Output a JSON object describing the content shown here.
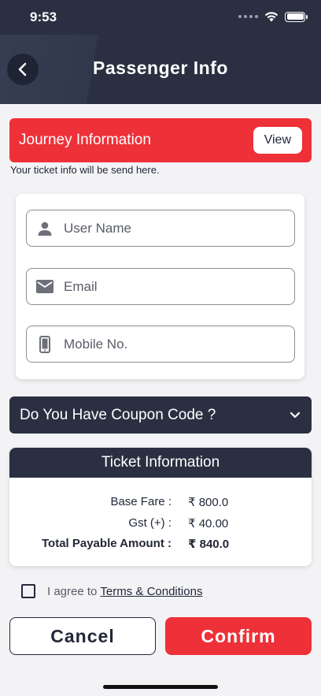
{
  "status_bar": {
    "time": "9:53",
    "icons": [
      "signal-dots-icon",
      "wifi-icon",
      "battery-icon"
    ]
  },
  "header": {
    "title": "Passenger Info",
    "back_icon": "chevron-left-icon"
  },
  "journey": {
    "title": "Journey Information",
    "view_label": "View",
    "hint": "Your ticket info will be send here."
  },
  "form": {
    "username": {
      "placeholder": "User Name",
      "value": "",
      "icon": "person-icon"
    },
    "email": {
      "placeholder": "Email",
      "value": "",
      "icon": "mail-icon"
    },
    "mobile": {
      "placeholder": "Mobile No.",
      "value": "",
      "icon": "phone-icon"
    }
  },
  "coupon": {
    "label": "Do You Have Coupon Code ?",
    "icon": "chevron-down-icon"
  },
  "ticket": {
    "title": "Ticket Information",
    "rows": [
      {
        "label": "Base Fare :",
        "value": "₹ 800.0"
      },
      {
        "label": "Gst (+) :",
        "value": "₹ 40.00"
      },
      {
        "label": "Total Payable Amount :",
        "value": "₹ 840.0"
      }
    ]
  },
  "agreement": {
    "prefix": "I agree to",
    "link": "Terms & Conditions",
    "checked": false
  },
  "actions": {
    "cancel_label": "Cancel",
    "confirm_label": "Confirm"
  },
  "colors": {
    "navy": "#2a3042",
    "accent_red": "#ee3139",
    "background": "#f3f3f5"
  }
}
